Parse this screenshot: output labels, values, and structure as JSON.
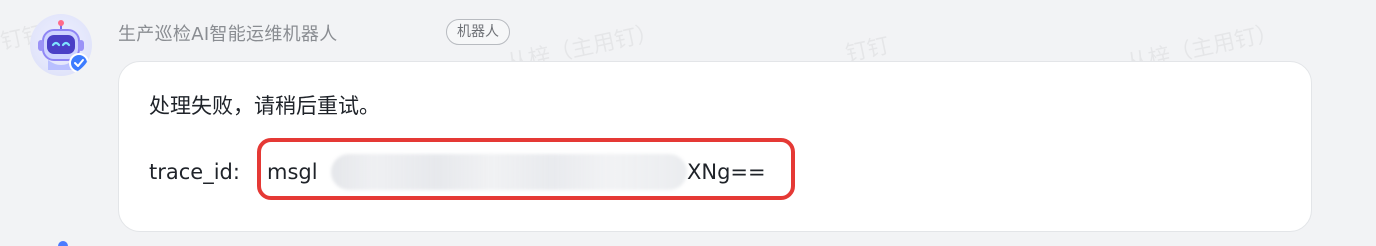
{
  "sender": {
    "name": "生产巡检AI智能运维机器人",
    "tag": "机器人"
  },
  "watermark": {
    "short": "钉钉",
    "long": "从梓（主用钉）"
  },
  "message": {
    "error_text": "处理失败，请稍后重试。",
    "trace_label": "trace_id:",
    "trace_value_visible_head": "msgl",
    "trace_value_visible_tail": "XNg==",
    "trace_redacted": true
  },
  "colors": {
    "highlight": "#e53935",
    "bubble_bg": "#ffffff",
    "page_bg": "#f2f3f5"
  },
  "icons": {
    "avatar": "robot-avatar-icon"
  }
}
